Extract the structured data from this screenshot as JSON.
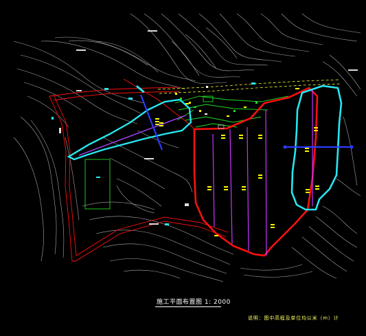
{
  "drawing": {
    "title": "施工平面布置图 1: 2000",
    "note": "说明：图中高程及单位均以米（m）计",
    "colors": {
      "background": "#000000",
      "contour": "#c8c8c8",
      "boundary_red": "#ff1010",
      "reservoir_cyan": "#28e6f0",
      "dam_axis_blue": "#2a3cff",
      "facility_green": "#22dd22",
      "magenta_lines": "#cc33ff",
      "labels_yellow": "#ffff00"
    }
  }
}
